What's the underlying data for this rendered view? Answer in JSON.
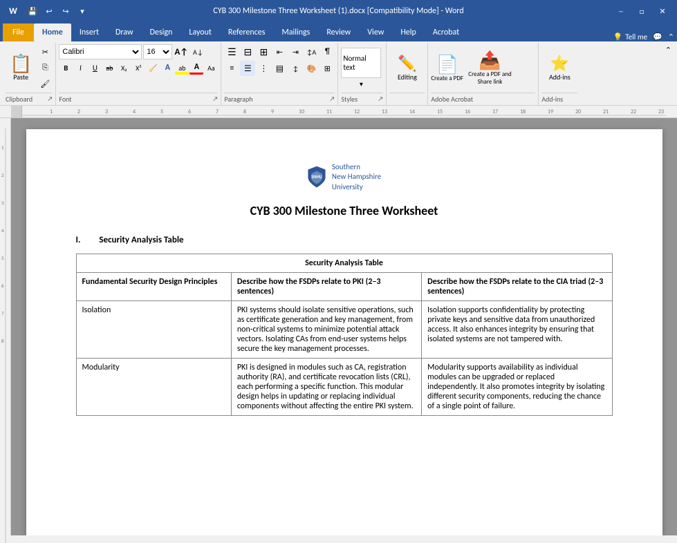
{
  "titlebar": {
    "filename": "CYB 300 Milestone Three Worksheet (1).docx [Compatibility Mode] - Word",
    "app": "Word",
    "quickaccess": [
      "save",
      "undo",
      "redo",
      "customize"
    ]
  },
  "tabs": {
    "file": "File",
    "home": "Home",
    "insert": "Insert",
    "draw": "Draw",
    "design": "Design",
    "layout": "Layout",
    "references": "References",
    "mailings": "Mailings",
    "review": "Review",
    "view": "View",
    "help": "Help",
    "acrobat": "Acrobat",
    "tellme": "Tell me",
    "comments": "Comments"
  },
  "ribbon": {
    "clipboard": {
      "label": "Clipboard",
      "paste_label": "Paste"
    },
    "font": {
      "label": "Font",
      "face": "Calibri",
      "size": "16",
      "bold": "B",
      "italic": "I",
      "underline": "U"
    },
    "paragraph": {
      "label": "Paragraph"
    },
    "styles": {
      "label": "Styles",
      "editing_label": "Editing"
    },
    "adobe_acrobat": {
      "label": "Adobe Acrobat",
      "create_pdf": "Create a PDF",
      "create_share": "Create a PDF and Share link"
    },
    "addins": {
      "label": "Add-ins"
    }
  },
  "document": {
    "university": "Southern\nNew Hampshire\nUniversity",
    "title": "CYB 300 Milestone Three Worksheet",
    "section1": {
      "number": "I.",
      "heading": "Security Analysis Table",
      "table": {
        "header": "Security Analysis Table",
        "col1": "Fundamental Security Design Principles",
        "col2": "Describe how the FSDPs relate to PKI (2–3 sentences)",
        "col3": "Describe how the FSDPs relate to the CIA triad (2–3 sentences)",
        "rows": [
          {
            "principle": "Isolation",
            "pki": "PKI systems should isolate sensitive operations, such as certificate generation and key management, from non-critical systems to minimize potential attack vectors. Isolating CAs from end-user systems helps secure the key management processes.",
            "cia": "Isolation supports confidentiality by protecting private keys and sensitive data from unauthorized access. It also enhances integrity by ensuring that isolated systems are not tampered with."
          },
          {
            "principle": "Modularity",
            "pki": "PKI is designed in modules such as CA, registration authority (RA), and certificate revocation lists (CRL), each performing a specific function. This modular design helps in updating or replacing individual components without affecting the entire PKI system.",
            "cia": "Modularity supports availability as individual modules can be upgraded or replaced independently. It also promotes integrity by isolating different security components, reducing the chance of a single point of failure."
          }
        ]
      }
    }
  }
}
